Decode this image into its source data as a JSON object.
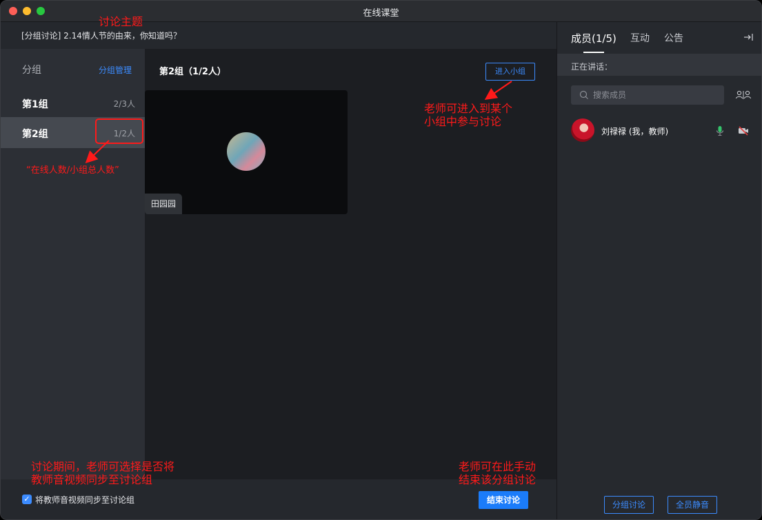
{
  "window": {
    "title": "在线课堂"
  },
  "topic": {
    "text": "[分组讨论] 2.14情人节的由来，你知道吗？"
  },
  "group_list": {
    "title": "分组",
    "manage_label": "分组管理",
    "items": [
      {
        "name": "第1组",
        "count": "2/3人"
      },
      {
        "name": "第2组",
        "count": "1/2人"
      }
    ]
  },
  "main": {
    "group_title": "第2组（1/2人）",
    "enter_label": "进入小组",
    "tile_name": "田园园"
  },
  "bottom": {
    "sync_label": "将教师音视频同步至讨论组",
    "end_label": "结束讨论"
  },
  "right_panel": {
    "tabs": [
      {
        "label": "成员(1/5)"
      },
      {
        "label": "互动"
      },
      {
        "label": "公告"
      }
    ],
    "speaking_label": "正在讲话：",
    "search_placeholder": "搜索成员",
    "member_name": "刘禄禄 (我，教师)",
    "group_discussion_label": "分组讨论",
    "mute_all_label": "全员静音"
  },
  "annotations": {
    "topic": "讨论主题",
    "enter_line1": "老师可进入到某个",
    "enter_line2": "小组中参与讨论",
    "count": "“在线人数/小组总人数”",
    "sync_line1": "讨论期间，老师可选择是否将",
    "sync_line2": "教师音视频同步至讨论组",
    "end_line1": "老师可在此手动",
    "end_line2": "结束该分组讨论"
  },
  "colors": {
    "accent": "#3c8cff",
    "primary_button": "#1b7cfa",
    "annotation_red": "#ff1a1a",
    "mic_active": "#34c36b",
    "cam_off": "#e23b3b"
  }
}
